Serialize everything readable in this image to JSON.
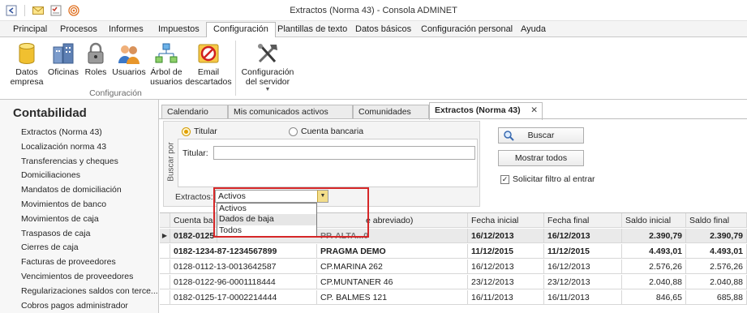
{
  "window": {
    "title": "Extractos (Norma 43) - Consola ADMINET"
  },
  "qat": {
    "icons": [
      "back-icon",
      "mail-icon",
      "checklist-icon",
      "broadcast-icon"
    ]
  },
  "ribbon_tabs": [
    "Principal",
    "Procesos",
    "Informes",
    "Impuestos",
    "Configuración",
    "Plantillas de texto",
    "Datos básicos",
    "Configuración personal",
    "Ayuda"
  ],
  "ribbon_active_tab": "Configuración",
  "ribbon": {
    "buttons": [
      {
        "label": "Datos\nempresa",
        "icon": "database-icon"
      },
      {
        "label": "Oficinas",
        "icon": "buildings-icon"
      },
      {
        "label": "Roles",
        "icon": "lock-icon"
      },
      {
        "label": "Usuarios",
        "icon": "users-icon"
      },
      {
        "label": "Árbol de\nusuarios",
        "icon": "tree-icon"
      },
      {
        "label": "Email\ndescartados",
        "icon": "blocked-mail-icon"
      },
      {
        "label": "Configuración\ndel servidor",
        "icon": "tools-icon"
      }
    ],
    "group_label": "Configuración"
  },
  "leftnav": {
    "title": "Contabilidad",
    "items": [
      "Extractos (Norma 43)",
      "Localización norma 43",
      "Transferencias y cheques",
      "Domiciliaciones",
      "Mandatos de domiciliación",
      "Movimientos de banco",
      "Movimientos de caja",
      "Traspasos de caja",
      "Cierres de caja",
      "Facturas de proveedores",
      "Vencimientos de proveedores",
      "Regularizaciones saldos con terce...",
      "Cobros pagos administrador"
    ]
  },
  "doc_tabs": {
    "items": [
      "Calendario",
      "Mis comunicados activos",
      "Comunidades",
      "Extractos (Norma 43)"
    ],
    "active": "Extractos (Norma 43)",
    "close_glyph": "✕"
  },
  "filter": {
    "group_label": "Buscar por",
    "radio_titular": "Titular",
    "radio_cuenta": "Cuenta bancaria",
    "titular_label": "Titular:",
    "titular_value": "",
    "extractos_label": "Extractos:",
    "extractos_value": "Activos",
    "options": [
      "Activos",
      "Dados de baja",
      "Todos"
    ],
    "hovered_option": "Dados de baja"
  },
  "actions": {
    "buscar": "Buscar",
    "mostrar_todos": "Mostrar todos",
    "solicitar": "Solicitar filtro al entrar",
    "solicitar_checked": true
  },
  "grid": {
    "columns": [
      "Cuenta banc",
      "e abreviado)",
      "Fecha inicial",
      "Fecha final",
      "Saldo inicial",
      "Saldo final"
    ],
    "rows": [
      {
        "cuenta": "0182-0125-",
        "nombre": "PP. ALTA...0",
        "fi": "16/12/2013",
        "ff": "16/12/2013",
        "si": "2.390,79",
        "sf": "2.390,79",
        "bold": true,
        "current": true
      },
      {
        "cuenta": "0182-1234-87-1234567899",
        "nombre": "PRAGMA DEMO",
        "fi": "11/12/2015",
        "ff": "11/12/2015",
        "si": "4.493,01",
        "sf": "4.493,01",
        "bold": true,
        "current": false
      },
      {
        "cuenta": "0128-0112-13-0013642587",
        "nombre": "CP.MARINA 262",
        "fi": "16/12/2013",
        "ff": "16/12/2013",
        "si": "2.576,26",
        "sf": "2.576,26",
        "bold": false,
        "current": false
      },
      {
        "cuenta": "0128-0122-96-0001118444",
        "nombre": "CP.MUNTANER 46",
        "fi": "23/12/2013",
        "ff": "23/12/2013",
        "si": "2.040,88",
        "sf": "2.040,88",
        "bold": false,
        "current": false
      },
      {
        "cuenta": "0182-0125-17-0002214444",
        "nombre": "CP. BALMES 121",
        "fi": "16/11/2013",
        "ff": "16/11/2013",
        "si": "846,65",
        "sf": "685,88",
        "bold": false,
        "current": false
      }
    ]
  },
  "colors": {
    "accent_tab": "#ffffff",
    "highlight": "#d62728",
    "combo_button": "#f3dd8a"
  }
}
